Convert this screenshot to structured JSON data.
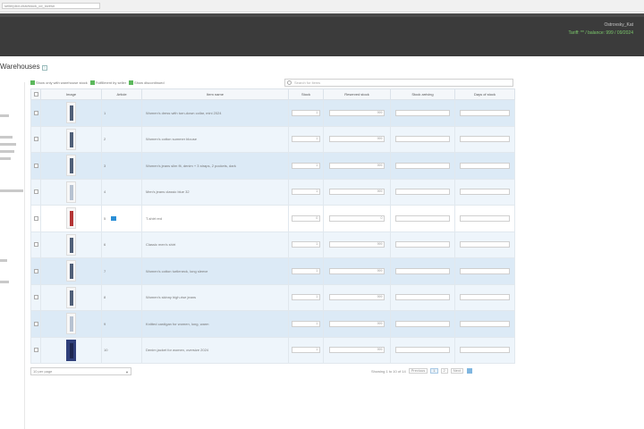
{
  "browser": {
    "url": "sellerpilot.chat/stock_cd_lovesn"
  },
  "header": {
    "account_name": "Ostrovsky_Kat",
    "account_status": "Tariff: ** / balance: 999 / 09/2024"
  },
  "page": {
    "title": "Warehouses",
    "help_label": "?"
  },
  "filters": [
    {
      "label": "Show only with warehouse stock"
    },
    {
      "label": "Fulfillment by seller"
    },
    {
      "label": "Show discontinued"
    }
  ],
  "search": {
    "placeholder": "Search for items"
  },
  "table": {
    "columns": [
      "",
      "Image",
      "Article",
      "Item name",
      "Stock",
      "Reserved stock",
      "Stock arriving",
      "Days of stock"
    ],
    "rows": [
      {
        "ref": "1",
        "name": "Women's dress with turn-down collar, mini 2024",
        "stock": "1",
        "reserved": "999",
        "arriving": "",
        "days": "",
        "thumb": "blue"
      },
      {
        "ref": "2",
        "name": "Women's cotton summer blouse",
        "stock": "1",
        "reserved": "999",
        "arriving": "",
        "days": "",
        "thumb": "blue"
      },
      {
        "ref": "3",
        "name": "Women's jeans slim fit, denim + 3 straps, 2 pockets, dark",
        "stock": "1",
        "reserved": "999",
        "arriving": "",
        "days": "",
        "thumb": "blue"
      },
      {
        "ref": "4",
        "name": "Men's jeans classic blue 32",
        "stock": "1",
        "reserved": "999",
        "arriving": "",
        "days": "",
        "thumb": "light"
      },
      {
        "ref": "5",
        "name": "T-shirt red",
        "stock": "0",
        "reserved": "0",
        "arriving": "",
        "days": "",
        "thumb": "red",
        "flag": true
      },
      {
        "ref": "6",
        "name": "Classic men's shirt",
        "stock": "1",
        "reserved": "999",
        "arriving": "",
        "days": "",
        "thumb": "blue"
      },
      {
        "ref": "7",
        "name": "Women's cotton turtleneck, long sleeve",
        "stock": "1",
        "reserved": "999",
        "arriving": "",
        "days": "",
        "thumb": "blue"
      },
      {
        "ref": "8",
        "name": "Women's skinny high-rise jeans",
        "stock": "1",
        "reserved": "999",
        "arriving": "",
        "days": "",
        "thumb": "blue"
      },
      {
        "ref": "9",
        "name": "Knitted cardigan for women, long, warm",
        "stock": "1",
        "reserved": "999",
        "arriving": "",
        "days": "",
        "thumb": "light"
      },
      {
        "ref": "10",
        "name": "Denim jacket for women, oversize 2024",
        "stock": "1",
        "reserved": "999",
        "arriving": "",
        "days": "",
        "thumb": "dark"
      }
    ]
  },
  "footer": {
    "page_size": "10 per page",
    "pagination_label": "Showing 1 to 10 of 14",
    "pages": [
      "Previous",
      "1",
      "2",
      "Next"
    ]
  }
}
